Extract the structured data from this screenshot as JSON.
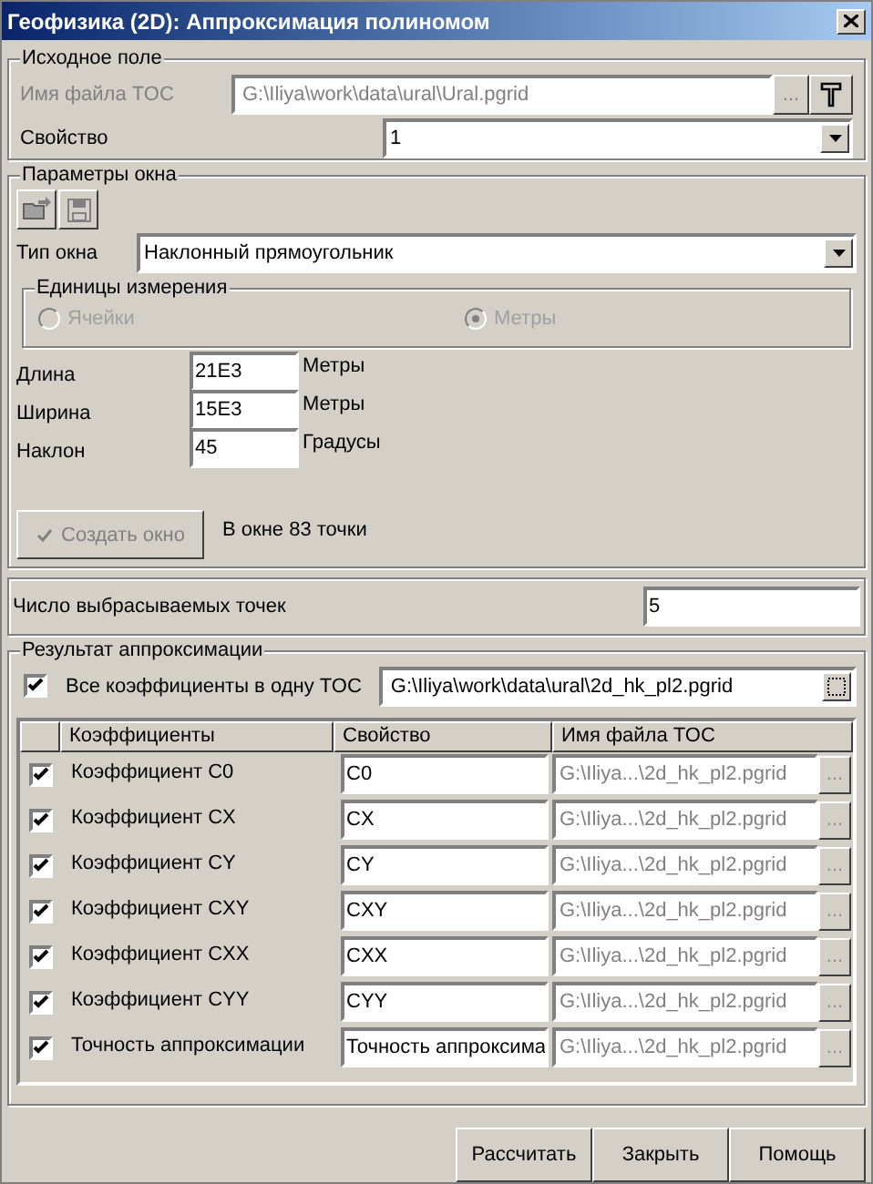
{
  "window": {
    "title": "Геофизика (2D): Аппроксимация полиномом"
  },
  "source_field": {
    "title": "Исходное поле",
    "file_label": "Имя файла TOC",
    "file_value": "G:\\Iliya\\work\\data\\ural\\Ural.pgrid",
    "file_disabled": true,
    "browse_label": "...",
    "property_label": "Свойство",
    "property_value": "1"
  },
  "window_params": {
    "title": "Параметры окна",
    "window_type_label": "Тип окна",
    "window_type_value": "Наклонный прямоугольник",
    "units": {
      "title": "Единицы измерения",
      "disabled": true,
      "options": [
        {
          "label": "Ячейки",
          "selected": false
        },
        {
          "label": "Метры",
          "selected": true
        }
      ]
    },
    "fields": [
      {
        "label": "Длина",
        "value": "21E3",
        "unit": "Метры"
      },
      {
        "label": "Ширина",
        "value": "15E3",
        "unit": "Метры"
      },
      {
        "label": "Наклон",
        "value": "45",
        "unit": "Градусы"
      }
    ],
    "create_button": {
      "label": "Создать окно",
      "disabled": true
    },
    "points_info": "В окне 83 точки"
  },
  "discard": {
    "label": "Число выбрасываемых точек",
    "value": "5"
  },
  "result": {
    "title": "Результат аппроксимации",
    "all_in_one": {
      "label": "Все коэффициенты в одну TOC",
      "checked": true,
      "value": "G:\\Iliya\\work\\data\\ural\\2d_hk_pl2.pgrid"
    },
    "columns": [
      "Коэффициенты",
      "Свойство",
      "Имя файла TOC"
    ],
    "rows": [
      {
        "checked": true,
        "name": "Коэффициент C0",
        "property": "C0",
        "file": "G:\\Iliya...\\2d_hk_pl2.pgrid",
        "browse": "...",
        "file_disabled": true
      },
      {
        "checked": true,
        "name": "Коэффициент CX",
        "property": "CX",
        "file": "G:\\Iliya...\\2d_hk_pl2.pgrid",
        "browse": "...",
        "file_disabled": true
      },
      {
        "checked": true,
        "name": "Коэффициент CY",
        "property": "CY",
        "file": "G:\\Iliya...\\2d_hk_pl2.pgrid",
        "browse": "...",
        "file_disabled": true
      },
      {
        "checked": true,
        "name": "Коэффициент CXY",
        "property": "CXY",
        "file": "G:\\Iliya...\\2d_hk_pl2.pgrid",
        "browse": "...",
        "file_disabled": true
      },
      {
        "checked": true,
        "name": "Коэффициент CXX",
        "property": "CXX",
        "file": "G:\\Iliya...\\2d_hk_pl2.pgrid",
        "browse": "...",
        "file_disabled": true
      },
      {
        "checked": true,
        "name": "Коэффициент CYY",
        "property": "CYY",
        "file": "G:\\Iliya...\\2d_hk_pl2.pgrid",
        "browse": "...",
        "file_disabled": true
      },
      {
        "checked": true,
        "name": "Точность аппроксимации",
        "property": "Точность аппроксима",
        "file": "G:\\Iliya...\\2d_hk_pl2.pgrid",
        "browse": "...",
        "file_disabled": true
      }
    ]
  },
  "buttons": [
    "Рассчитать",
    "Закрыть",
    "Помощь"
  ]
}
